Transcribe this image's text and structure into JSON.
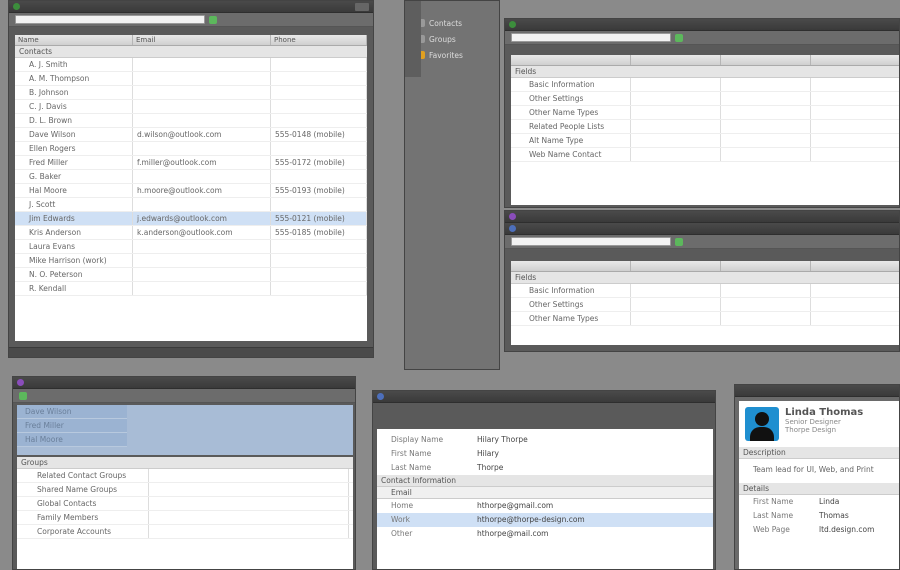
{
  "window_a": {
    "title": "",
    "search_placeholder": "",
    "columns": [
      "Name",
      "Email",
      "Phone"
    ],
    "group_label": "Contacts",
    "rows": [
      {
        "name": "A. J. Smith",
        "email": "",
        "phone": ""
      },
      {
        "name": "A. M. Thompson",
        "email": "",
        "phone": ""
      },
      {
        "name": "B. Johnson",
        "email": "",
        "phone": ""
      },
      {
        "name": "C. J. Davis",
        "email": "",
        "phone": ""
      },
      {
        "name": "D. L. Brown",
        "email": "",
        "phone": ""
      },
      {
        "name": "Dave Wilson",
        "email": "d.wilson@outlook.com",
        "phone": "555-0148 (mobile)"
      },
      {
        "name": "Ellen Rogers",
        "email": "",
        "phone": ""
      },
      {
        "name": "Fred Miller",
        "email": "f.miller@outlook.com",
        "phone": "555-0172 (mobile)"
      },
      {
        "name": "G. Baker",
        "email": "",
        "phone": ""
      },
      {
        "name": "Hal Moore",
        "email": "h.moore@outlook.com",
        "phone": "555-0193 (mobile)"
      },
      {
        "name": "J. Scott",
        "email": "",
        "phone": ""
      },
      {
        "name": "Jim Edwards",
        "email": "j.edwards@outlook.com",
        "phone": "555-0121 (mobile)"
      },
      {
        "name": "Kris Anderson",
        "email": "k.anderson@outlook.com",
        "phone": "555-0185 (mobile)"
      },
      {
        "name": "Laura Evans",
        "email": "",
        "phone": ""
      },
      {
        "name": "Mike Harrison (work)",
        "email": "",
        "phone": ""
      },
      {
        "name": "N. O. Peterson",
        "email": "",
        "phone": ""
      },
      {
        "name": "R. Kendall",
        "email": "",
        "phone": ""
      }
    ],
    "selected_index": 11
  },
  "sidebar_mid": {
    "items": [
      "Contacts",
      "Groups",
      "Favorites"
    ]
  },
  "window_b": {
    "group_label": "Fields",
    "rows": [
      "Basic Information",
      "Other Settings",
      "Other Name Types",
      "Related People Lists",
      "Alt Name Type",
      "Web Name Contact"
    ]
  },
  "window_c": {
    "group_label": "Fields",
    "rows": [
      "Basic Information",
      "Other Settings",
      "Other Name Types"
    ]
  },
  "window_d": {
    "selected_rows": [
      "Dave Wilson",
      "Fred Miller",
      "Hal Moore"
    ],
    "group_label": "Groups",
    "rows": [
      "Related Contact Groups",
      "Shared Name Groups",
      "Global Contacts",
      "Family Members",
      "Corporate Accounts"
    ]
  },
  "window_e": {
    "kv": [
      {
        "k": "Display Name",
        "v": "Hilary Thorpe"
      },
      {
        "k": "First Name",
        "v": "Hilary"
      },
      {
        "k": "Last Name",
        "v": "Thorpe"
      }
    ],
    "section": "Contact Information",
    "subsection": "Email",
    "rows": [
      {
        "k": "Home",
        "v": "hthorpe@gmail.com"
      },
      {
        "k": "Work",
        "v": "hthorpe@thorpe-design.com"
      },
      {
        "k": "Other",
        "v": "hthorpe@mail.com"
      }
    ],
    "selected_index": 1
  },
  "window_f": {
    "name": "Linda Thomas",
    "subtitle1": "Senior Designer",
    "subtitle2": "Thorpe Design",
    "about_label": "Description",
    "about_text": "Team lead for UI, Web, and Print",
    "section_label": "Details",
    "kv": [
      {
        "k": "First Name",
        "v": "Linda"
      },
      {
        "k": "Last Name",
        "v": "Thomas"
      },
      {
        "k": "Web Page",
        "v": "ltd.design.com"
      }
    ]
  },
  "colors": {
    "accent": "#5cb85c",
    "selection": "#cfe0f5",
    "avatar": "#1f8fd0",
    "bg": "#8a8a8a"
  }
}
